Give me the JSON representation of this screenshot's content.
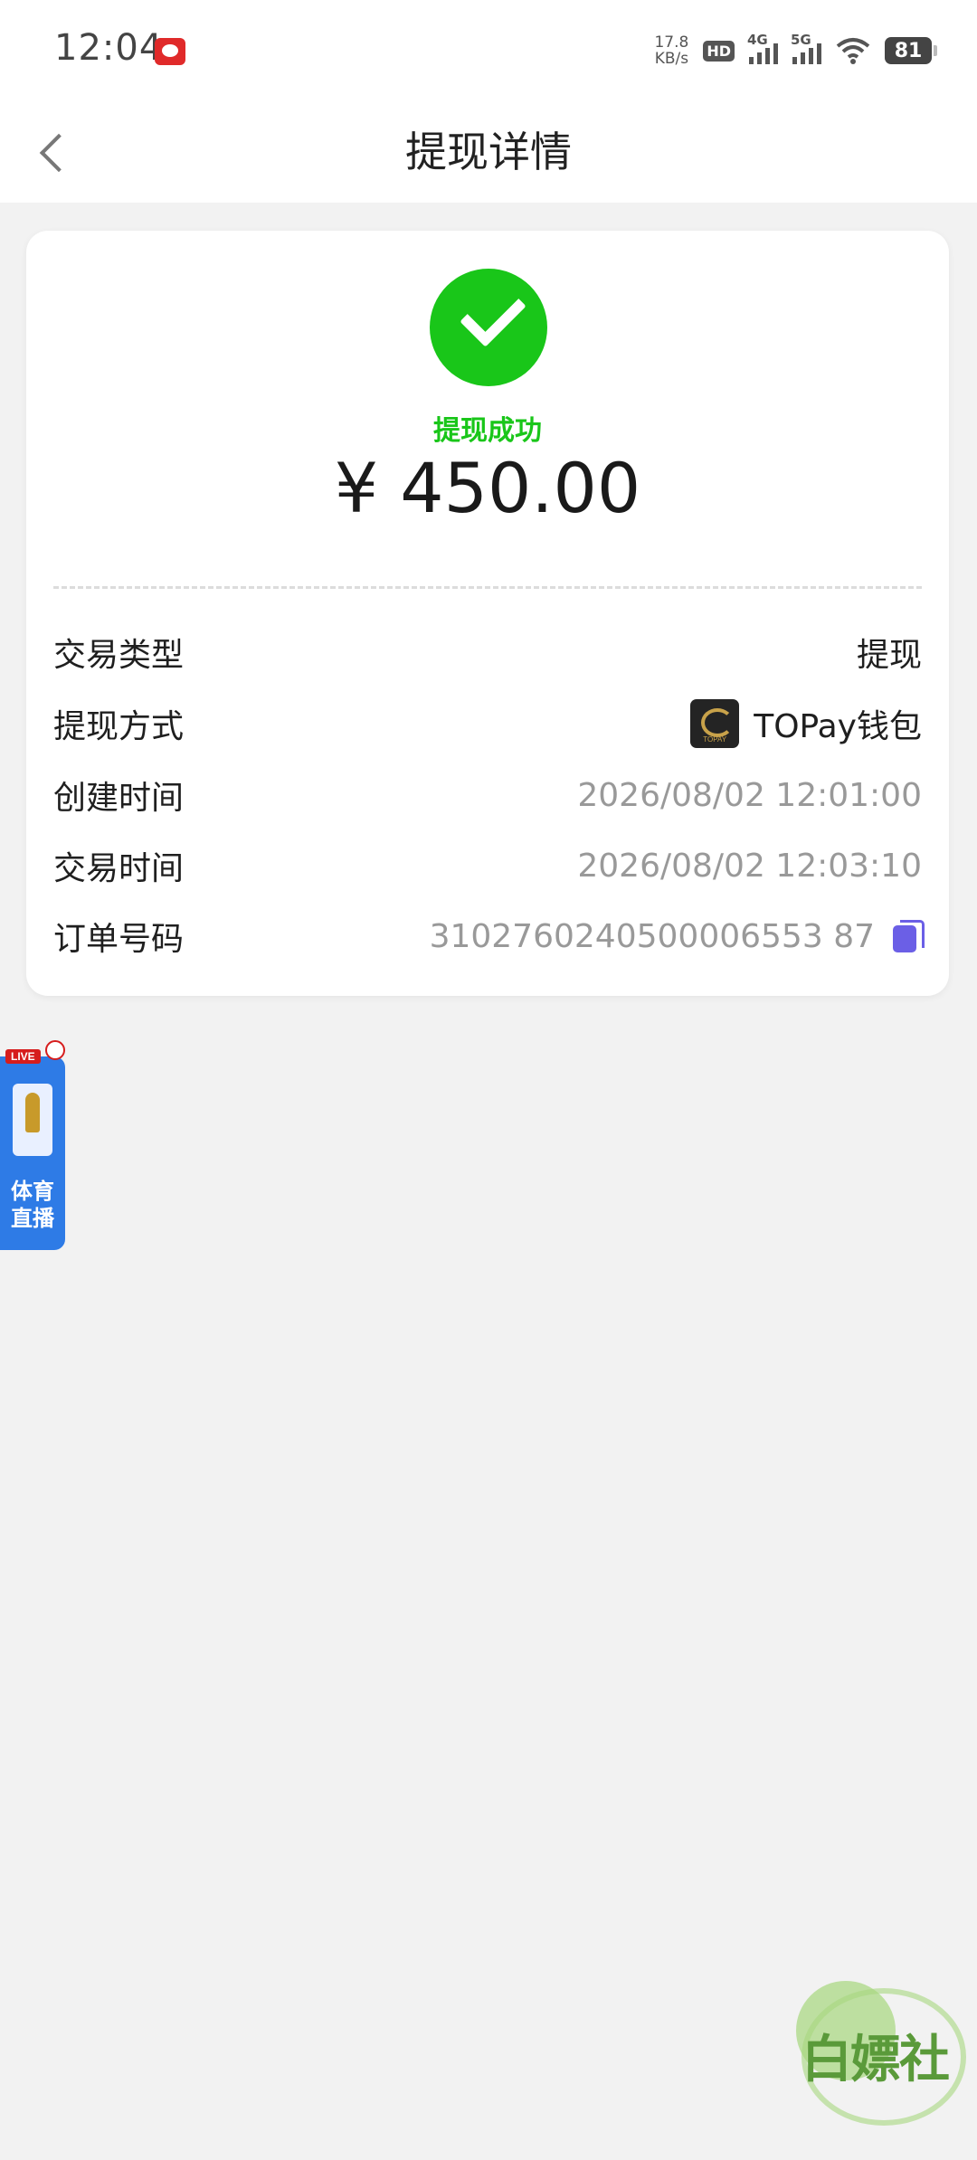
{
  "status_bar": {
    "time": "12:04",
    "net_speed_value": "17.8",
    "net_speed_unit": "KB/s",
    "hd_label": "HD",
    "signal_1_label": "4G",
    "signal_2_label": "5G",
    "battery": "81"
  },
  "header": {
    "title": "提现详情"
  },
  "summary": {
    "status": "提现成功",
    "amount": "¥ 450.00",
    "status_color": "#19c619"
  },
  "details": [
    {
      "label": "交易类型",
      "value": "提现"
    },
    {
      "label": "提现方式",
      "value": "TOPay钱包",
      "icon": "topay-logo-icon"
    },
    {
      "label": "创建时间",
      "value": "2026/08/02 12:01:00"
    },
    {
      "label": "交易时间",
      "value": "2026/08/02 12:03:10"
    },
    {
      "label": "订单号码",
      "value": "3102760240500006553 87",
      "icon": "copy-icon"
    }
  ],
  "floating_widget": {
    "badge": "LIVE",
    "label_line1": "体育",
    "label_line2": "直播"
  },
  "watermark": {
    "text": "白嫖社"
  },
  "colors": {
    "accent_green": "#19c619",
    "copy_icon": "#6b5fe6",
    "widget_blue": "#2e7be6"
  }
}
